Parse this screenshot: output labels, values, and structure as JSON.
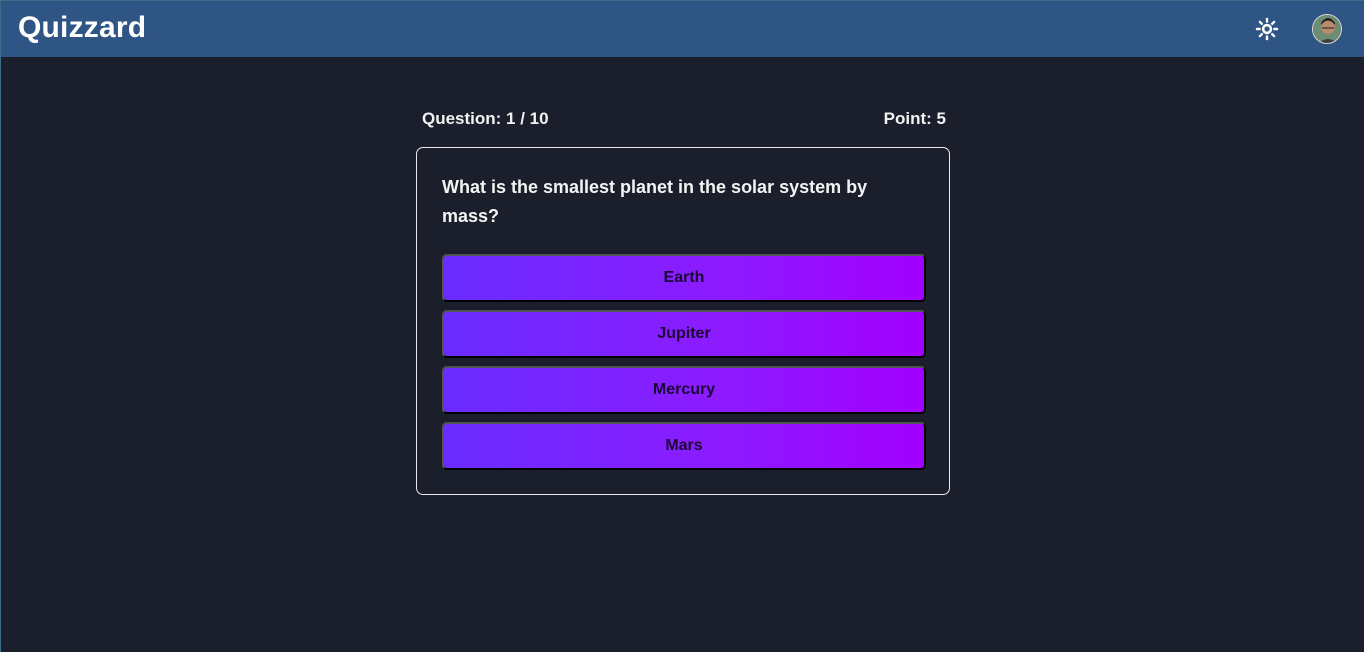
{
  "app": {
    "title": "Quizzard"
  },
  "header": {
    "theme_icon": "sun-icon",
    "avatar_icon": "user-avatar"
  },
  "quiz": {
    "question_status": "Question: 1 / 10",
    "points": "Point: 5",
    "question": "What is the smallest planet in the solar system by mass?",
    "options": [
      "Earth",
      "Jupiter",
      "Mercury",
      "Mars"
    ]
  },
  "colors": {
    "header_bg": "#2e5584",
    "page_bg": "#1b1f2b",
    "option_gradient_start": "#6a2dff",
    "option_gradient_end": "#a300ff"
  }
}
